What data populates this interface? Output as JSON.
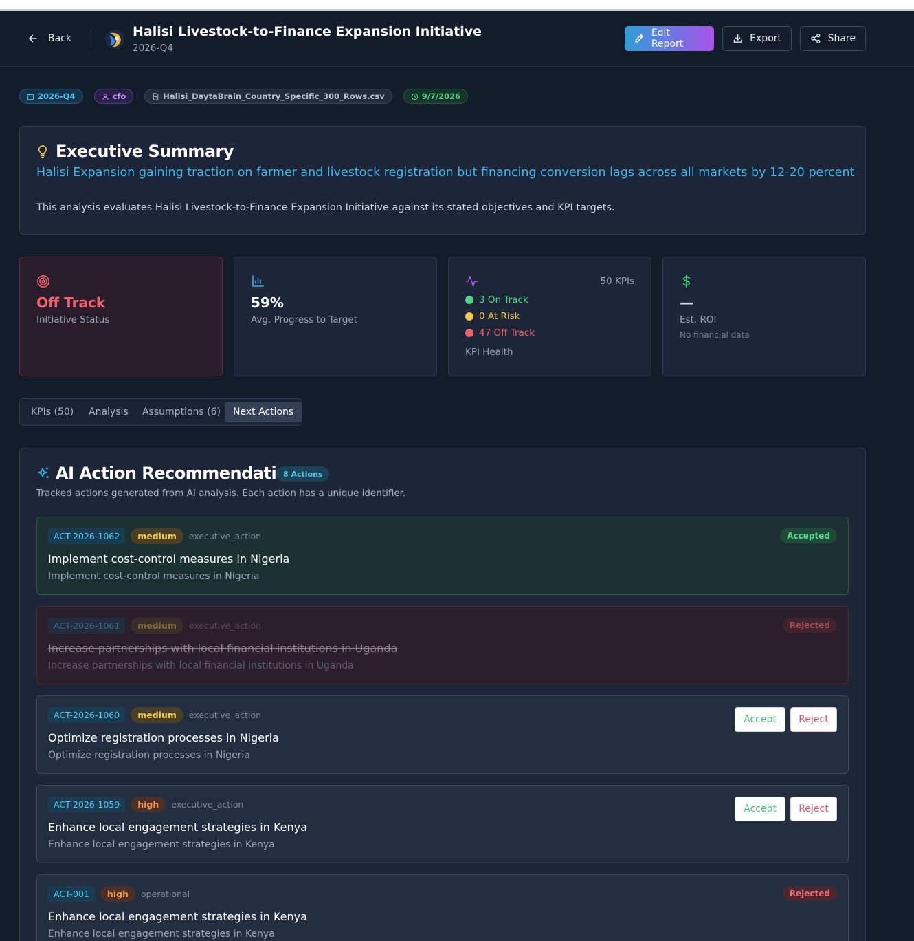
{
  "header": {
    "back_label": "Back",
    "title": "Halisi Livestock-to-Finance Expansion Initiative",
    "period": "2026-Q4",
    "edit_label": "Edit Report",
    "export_label": "Export",
    "share_label": "Share"
  },
  "chips": {
    "quarter": "2026-Q4",
    "role": "cfo",
    "file": "Halisi_DaytaBrain_Country_Specific_300_Rows.csv",
    "date": "9/7/2026"
  },
  "summary": {
    "title": "Executive Summary",
    "headline": "Halisi Expansion gaining traction on farmer and livestock registration but financing conversion lags across all markets by 12-20 percent",
    "description": "This analysis evaluates Halisi Livestock-to-Finance Expansion Initiative against its stated objectives and KPI targets."
  },
  "stats": {
    "status": {
      "value": "Off Track",
      "label": "Initiative Status"
    },
    "progress": {
      "value": "59%",
      "label": "Avg. Progress to Target",
      "fraction": 0.59
    },
    "health": {
      "count": "50 KPIs",
      "on_track": "3 On Track",
      "at_risk": "0 At Risk",
      "off_track": "47 Off Track",
      "label": "KPI Health"
    },
    "roi": {
      "value": "—",
      "label": "Est. ROI",
      "sub": "No financial data"
    }
  },
  "tabs": [
    "KPIs (50)",
    "Analysis",
    "Assumptions (6)",
    "Next Actions"
  ],
  "active_tab": "Next Actions",
  "actions": {
    "title": "AI Action Recommendations",
    "count": "8 Actions",
    "lead": "Tracked actions generated from AI analysis. Each action has a unique identifier.",
    "accept_label": "Accept",
    "reject_label": "Reject",
    "items": [
      {
        "id": "ACT-2026-1062",
        "priority": "medium",
        "category": "executive_action",
        "title": "Implement cost-control measures in Nigeria",
        "desc": "Implement cost-control measures in Nigeria",
        "status": "Accepted"
      },
      {
        "id": "ACT-2026-1061",
        "priority": "medium",
        "category": "executive_action",
        "title": "Increase partnerships with local financial institutions in Uganda",
        "desc": "Increase partnerships with local financial institutions in Uganda",
        "status": "Rejected"
      },
      {
        "id": "ACT-2026-1060",
        "priority": "medium",
        "category": "executive_action",
        "title": "Optimize registration processes in Nigeria",
        "desc": "Optimize registration processes in Nigeria",
        "status": ""
      },
      {
        "id": "ACT-2026-1059",
        "priority": "high",
        "category": "executive_action",
        "title": "Enhance local engagement strategies in Kenya",
        "desc": "Enhance local engagement strategies in Kenya",
        "status": ""
      },
      {
        "id": "ACT-001",
        "priority": "high",
        "category": "operational",
        "title": "Enhance local engagement strategies in Kenya",
        "desc": "Enhance local engagement strategies in Kenya",
        "status": "Rejected"
      }
    ]
  },
  "colors": {
    "background": "#131c2b",
    "accent": "#3fb6e8",
    "off_track": "#f0606a",
    "on_track": "#4fd489",
    "at_risk": "#f2c94c"
  }
}
